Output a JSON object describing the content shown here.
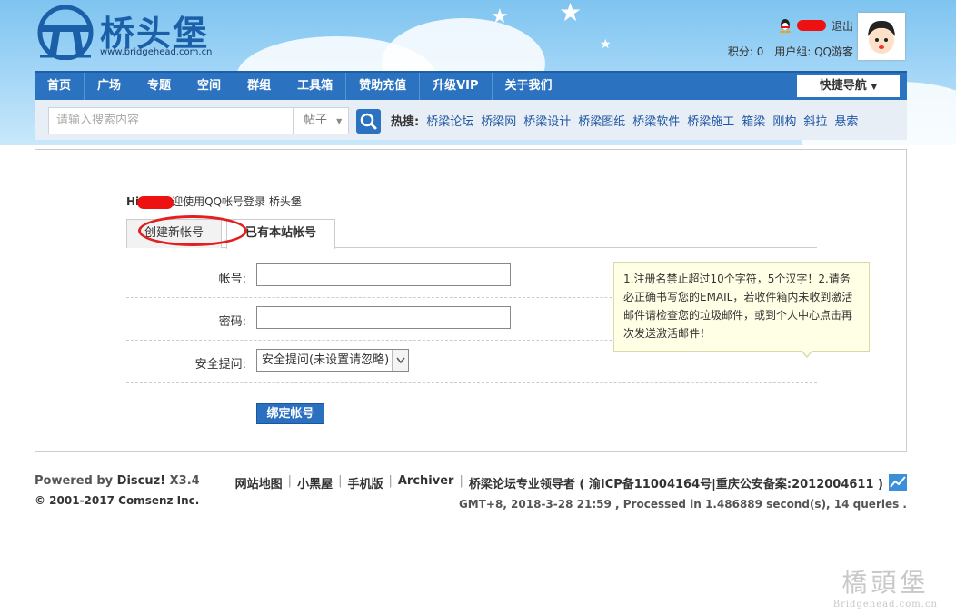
{
  "header": {
    "logo_text": "桥头堡",
    "logo_url": "www.bridgehead.com.cn",
    "logout": "退出",
    "points": "积分: 0",
    "usergroup": "用户组: QQ游客"
  },
  "nav": {
    "items": [
      "首页",
      "广场",
      "专题",
      "空间",
      "群组",
      "工具箱",
      "赞助充值",
      "升级VIP",
      "关于我们"
    ],
    "quicknav": "快捷导航"
  },
  "search": {
    "placeholder": "请输入搜索内容",
    "type": "帖子",
    "hot_label": "热搜:",
    "hot_terms": [
      "桥梁论坛",
      "桥梁网",
      "桥梁设计",
      "桥梁图纸",
      "桥梁软件",
      "桥梁施工",
      "箱梁",
      "刚构",
      "斜拉",
      "悬索"
    ]
  },
  "main": {
    "greet_hi": "Hi",
    "greet_text": "迎使用QQ帐号登录 桥头堡",
    "tabs": [
      "创建新帐号",
      "已有本站帐号"
    ],
    "form": {
      "account_label": "帐号:",
      "password_label": "密码:",
      "question_label": "安全提问:",
      "question_value": "安全提问(未设置请忽略)"
    },
    "tooltip": "1.注册名禁止超过10个字符，5个汉字！2.请务必正确书写您的EMAIL，若收件箱内未收到激活邮件请检查您的垃圾邮件，或到个人中心点击再次发送激活邮件！",
    "submit": "绑定帐号"
  },
  "footer": {
    "powered": "Powered by",
    "brand": "Discuz!",
    "version": "X3.4",
    "copyright": "© 2001-2017 Comsenz Inc.",
    "links": [
      "网站地图",
      "小黑屋",
      "手机版",
      "Archiver",
      "桥梁论坛专业领导者 ( 渝ICP备11004164号|重庆公安备案:2012004611 )"
    ],
    "stats": "GMT+8, 2018-3-28 21:59 , Processed in 1.486889 second(s), 14 queries ."
  },
  "watermark": {
    "line1": "橋頭堡",
    "line2": "Bridgehead.com.cn"
  },
  "colors": {
    "nav_bg": "#2b73c0",
    "link": "#1f57a4",
    "highlight": "#e12020"
  }
}
